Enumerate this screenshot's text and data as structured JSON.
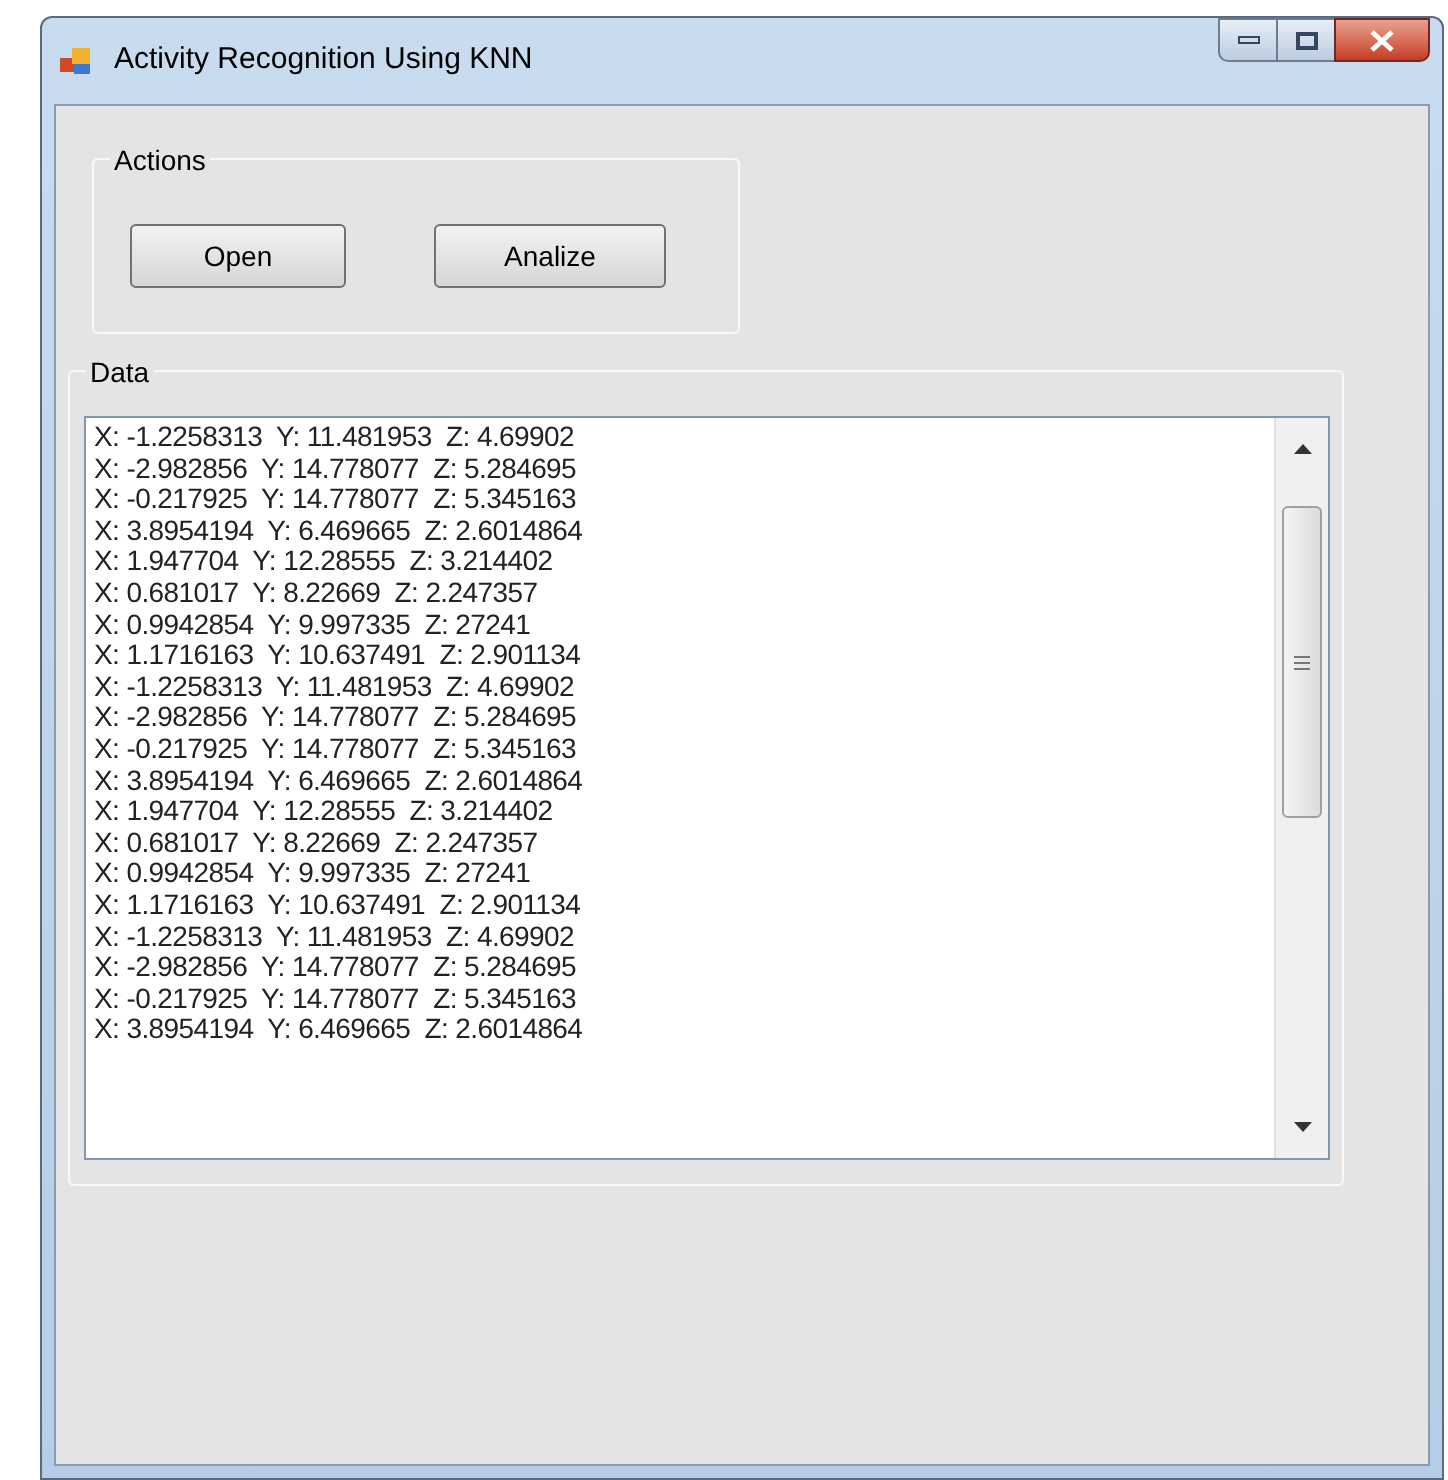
{
  "window": {
    "title": "Activity Recognition Using KNN"
  },
  "actions": {
    "title": "Actions",
    "buttons": [
      "Open",
      "Analize"
    ]
  },
  "data": {
    "title": "Data",
    "lines": [
      "X: -1.2258313  Y: 11.481953  Z: 4.69902",
      "X: -2.982856  Y: 14.778077  Z: 5.284695",
      "X: -0.217925  Y: 14.778077  Z: 5.345163",
      "X: 3.8954194  Y: 6.469665  Z: 2.6014864",
      "X: 1.947704  Y: 12.28555  Z: 3.214402",
      "X: 0.681017  Y: 8.22669  Z: 2.247357",
      "X: 0.9942854  Y: 9.997335  Z: 27241",
      "X: 1.1716163  Y: 10.637491  Z: 2.901134",
      "X: -1.2258313  Y: 11.481953  Z: 4.69902",
      "X: -2.982856  Y: 14.778077  Z: 5.284695",
      "X: -0.217925  Y: 14.778077  Z: 5.345163",
      "X: 3.8954194  Y: 6.469665  Z: 2.6014864",
      "X: 1.947704  Y: 12.28555  Z: 3.214402",
      "X: 0.681017  Y: 8.22669  Z: 2.247357",
      "X: 0.9942854  Y: 9.997335  Z: 27241",
      "X: 1.1716163  Y: 10.637491  Z: 2.901134",
      "X: -1.2258313  Y: 11.481953  Z: 4.69902",
      "X: -2.982856  Y: 14.778077  Z: 5.284695",
      "X: -0.217925  Y: 14.778077  Z: 5.345163",
      "X: 3.8954194  Y: 6.469665  Z: 2.6014864"
    ]
  }
}
